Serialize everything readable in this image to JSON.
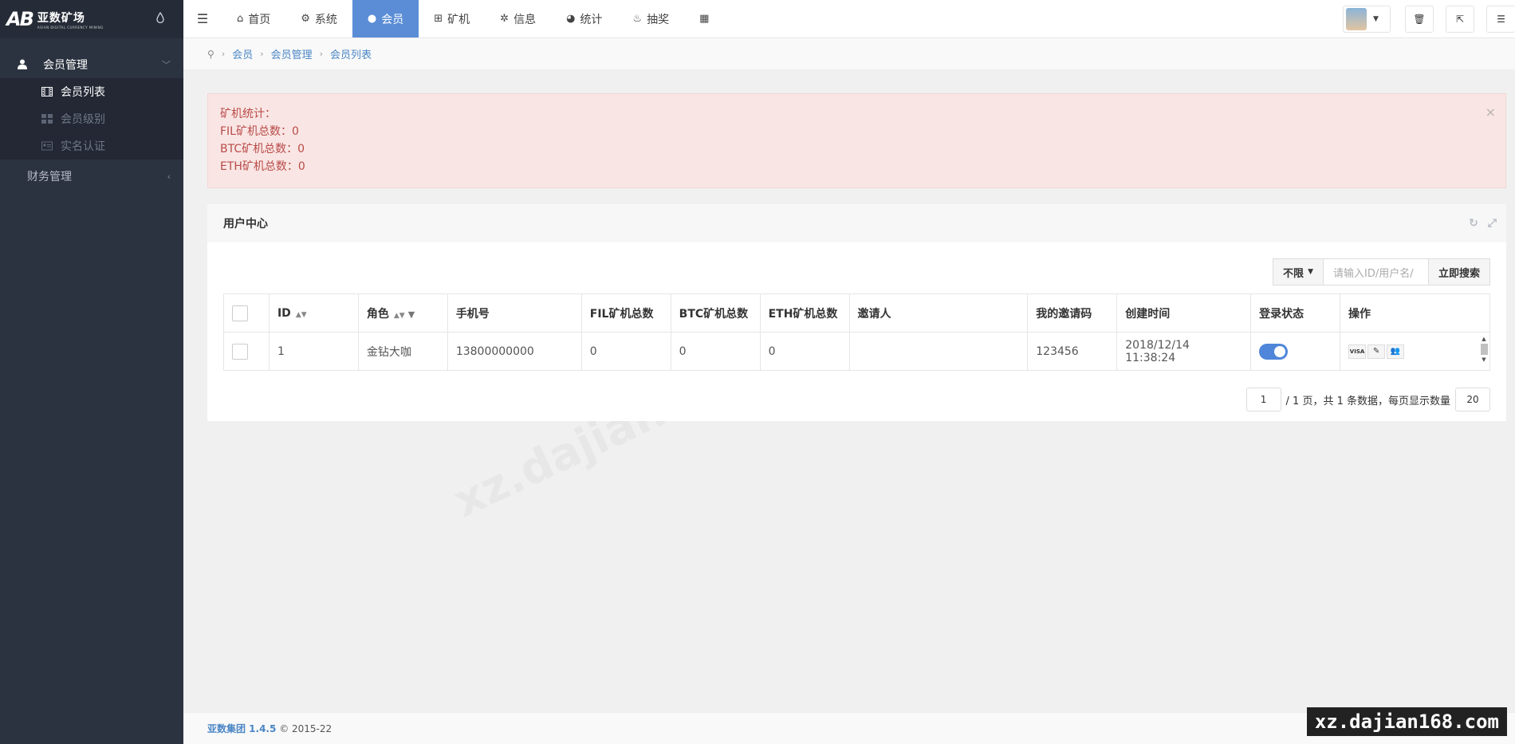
{
  "logo": {
    "cn": "亚数矿场",
    "en": "ASIAN DIGITAL CURRENCY MINING",
    "mark": "AB"
  },
  "sidebar": {
    "groups": [
      {
        "label": "会员管理",
        "items": [
          {
            "label": "会员列表",
            "active": true
          },
          {
            "label": "会员级别",
            "active": false
          },
          {
            "label": "实名认证",
            "active": false
          }
        ]
      },
      {
        "label": "财务管理"
      }
    ]
  },
  "topnav": {
    "items": [
      {
        "label": "首页",
        "icon": "home-icon"
      },
      {
        "label": "系统",
        "icon": "gear-icon"
      },
      {
        "label": "会员",
        "icon": "user-icon",
        "active": true
      },
      {
        "label": "矿机",
        "icon": "windows-icon"
      },
      {
        "label": "信息",
        "icon": "yelp-icon"
      },
      {
        "label": "统计",
        "icon": "pie-chart-icon"
      },
      {
        "label": "抽奖",
        "icon": "money-icon"
      }
    ]
  },
  "breadcrumb": [
    "会员",
    "会员管理",
    "会员列表"
  ],
  "alert": {
    "lines": [
      "矿机统计：",
      "FIL矿机总数：0",
      "BTC矿机总数：0",
      "ETH矿机总数：0"
    ]
  },
  "panel": {
    "title": "用户中心",
    "search": {
      "select_label": "不限",
      "placeholder": "请输入ID/用户名/",
      "button": "立即搜索"
    },
    "columns": [
      "ID",
      "角色",
      "手机号",
      "FIL矿机总数",
      "BTC矿机总数",
      "ETH矿机总数",
      "邀请人",
      "我的邀请码",
      "创建时间",
      "登录状态",
      "操作"
    ],
    "rows": [
      {
        "id": "1",
        "role": "金钻大咖",
        "phone": "13800000000",
        "fil": "0",
        "btc": "0",
        "eth": "0",
        "inviter": "",
        "code": "123456",
        "created": "2018/12/14 11:38:24",
        "login_enabled": true
      }
    ],
    "pager": {
      "page": "1",
      "total_pages_text": "/ 1 页，共 1 条数据，每页显示数量",
      "per_page": "20"
    }
  },
  "footer": {
    "brand": "亚数集团 1.4.5",
    "copyright": "© 2015-22"
  },
  "watermark": "xz.dajian168.com",
  "colors": {
    "sidebar_bg": "#2c3340",
    "accent": "#5a8dd6",
    "alert_bg": "#f9e6e4",
    "alert_text": "#b94a48",
    "toggle_on": "#4f86d9"
  }
}
